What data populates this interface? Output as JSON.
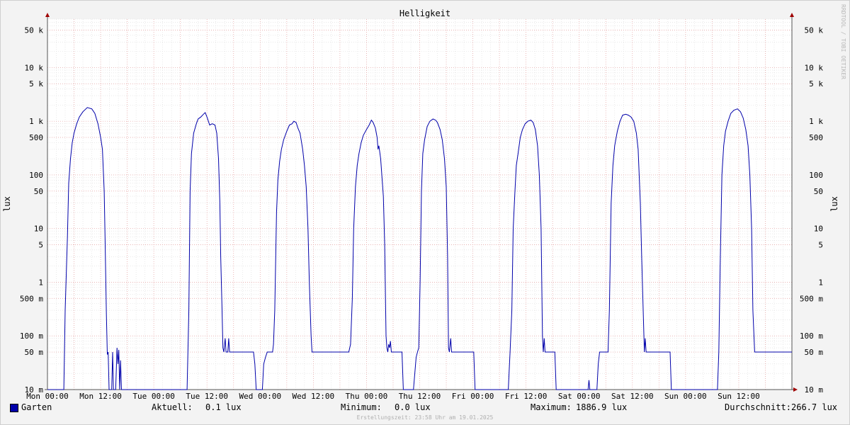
{
  "chart_data": {
    "type": "line",
    "title": "Helligkeit",
    "ylabel": "lux",
    "yscale": "log",
    "ylim": [
      0.01,
      80000
    ],
    "y_ticks": [
      0.01,
      0.05,
      0.1,
      0.5,
      1,
      5,
      10,
      50,
      100,
      500,
      1000,
      5000,
      10000,
      50000
    ],
    "y_tick_labels": [
      "10 m",
      "50 m",
      "100 m",
      "500 m",
      "1",
      "5",
      "10",
      "50",
      "100",
      "500",
      "1 k",
      "5 k",
      "10 k",
      "50 k"
    ],
    "x_ticks": [
      "Mon 00:00",
      "Mon 12:00",
      "Tue 00:00",
      "Tue 12:00",
      "Wed 00:00",
      "Wed 12:00",
      "Thu 00:00",
      "Thu 12:00",
      "Fri 00:00",
      "Fri 12:00",
      "Sat 00:00",
      "Sat 12:00",
      "Sun 00:00",
      "Sun 12:00"
    ],
    "x_hours": [
      0,
      12,
      24,
      36,
      48,
      60,
      72,
      84,
      96,
      108,
      120,
      132,
      144,
      156
    ],
    "xlim_hours": [
      0,
      168
    ],
    "grid": true,
    "series": [
      {
        "name": "Garten",
        "color": "#0000aa",
        "points": [
          [
            0,
            0.01
          ],
          [
            3.7,
            0.01
          ],
          [
            4.0,
            0.3
          ],
          [
            4.5,
            7
          ],
          [
            4.8,
            70
          ],
          [
            5.2,
            200
          ],
          [
            5.6,
            400
          ],
          [
            6.0,
            600
          ],
          [
            6.6,
            900
          ],
          [
            7.2,
            1200
          ],
          [
            8.0,
            1500
          ],
          [
            9.0,
            1800
          ],
          [
            10.0,
            1700
          ],
          [
            10.7,
            1400
          ],
          [
            11.4,
            900
          ],
          [
            12.0,
            500
          ],
          [
            12.4,
            300
          ],
          [
            12.8,
            50
          ],
          [
            13.0,
            7
          ],
          [
            13.3,
            0.25
          ],
          [
            13.5,
            0.045
          ],
          [
            13.7,
            0.05
          ],
          [
            13.9,
            0.01
          ],
          [
            14.5,
            0.01
          ],
          [
            14.7,
            0.05
          ],
          [
            14.9,
            0.01
          ],
          [
            15.4,
            0.01
          ],
          [
            15.7,
            0.06
          ],
          [
            15.9,
            0.03
          ],
          [
            16.1,
            0.055
          ],
          [
            16.3,
            0.01
          ],
          [
            16.5,
            0.035
          ],
          [
            16.7,
            0.01
          ],
          [
            24.0,
            0.01
          ],
          [
            31.5,
            0.01
          ],
          [
            31.7,
            0.05
          ],
          [
            31.9,
            0.3
          ],
          [
            32.2,
            50
          ],
          [
            32.5,
            250
          ],
          [
            33.0,
            600
          ],
          [
            33.6,
            900
          ],
          [
            34.0,
            1100
          ],
          [
            34.6,
            1200
          ],
          [
            35.2,
            1350
          ],
          [
            35.6,
            1450
          ],
          [
            36.0,
            1200
          ],
          [
            36.6,
            850
          ],
          [
            37.2,
            900
          ],
          [
            37.8,
            850
          ],
          [
            38.2,
            600
          ],
          [
            38.6,
            200
          ],
          [
            38.9,
            30
          ],
          [
            39.1,
            3
          ],
          [
            39.4,
            0.3
          ],
          [
            39.6,
            0.06
          ],
          [
            39.8,
            0.05
          ],
          [
            40.1,
            0.09
          ],
          [
            40.3,
            0.05
          ],
          [
            40.7,
            0.05
          ],
          [
            40.9,
            0.09
          ],
          [
            41.1,
            0.05
          ],
          [
            46.5,
            0.05
          ],
          [
            46.8,
            0.03
          ],
          [
            47.1,
            0.01
          ],
          [
            48.5,
            0.01
          ],
          [
            48.8,
            0.03
          ],
          [
            49.2,
            0.04
          ],
          [
            49.6,
            0.05
          ],
          [
            50.8,
            0.05
          ],
          [
            51.0,
            0.07
          ],
          [
            51.3,
            0.3
          ],
          [
            51.7,
            20
          ],
          [
            52.0,
            80
          ],
          [
            52.4,
            180
          ],
          [
            52.8,
            300
          ],
          [
            53.3,
            450
          ],
          [
            54.0,
            650
          ],
          [
            54.6,
            850
          ],
          [
            55.2,
            900
          ],
          [
            55.6,
            1000
          ],
          [
            56.1,
            950
          ],
          [
            56.5,
            750
          ],
          [
            57.0,
            600
          ],
          [
            57.6,
            300
          ],
          [
            58.0,
            150
          ],
          [
            58.4,
            60
          ],
          [
            58.8,
            10
          ],
          [
            59.1,
            1
          ],
          [
            59.5,
            0.1
          ],
          [
            59.7,
            0.05
          ],
          [
            68.0,
            0.05
          ],
          [
            68.4,
            0.07
          ],
          [
            68.8,
            0.5
          ],
          [
            69.1,
            10
          ],
          [
            69.5,
            60
          ],
          [
            69.9,
            150
          ],
          [
            70.3,
            250
          ],
          [
            70.8,
            400
          ],
          [
            71.3,
            550
          ],
          [
            72.0,
            700
          ],
          [
            72.6,
            850
          ],
          [
            73.1,
            1050
          ],
          [
            73.5,
            950
          ],
          [
            74.0,
            750
          ],
          [
            74.4,
            500
          ],
          [
            74.6,
            300
          ],
          [
            74.8,
            350
          ],
          [
            75.2,
            200
          ],
          [
            75.8,
            40
          ],
          [
            76.1,
            5
          ],
          [
            76.4,
            0.1
          ],
          [
            76.6,
            0.06
          ],
          [
            76.8,
            0.05
          ],
          [
            77.0,
            0.07
          ],
          [
            77.2,
            0.06
          ],
          [
            77.4,
            0.08
          ],
          [
            77.6,
            0.05
          ],
          [
            80.0,
            0.05
          ],
          [
            80.3,
            0.01
          ],
          [
            82.6,
            0.01
          ],
          [
            82.9,
            0.02
          ],
          [
            83.2,
            0.04
          ],
          [
            83.5,
            0.05
          ],
          [
            83.8,
            0.06
          ],
          [
            84.1,
            1
          ],
          [
            84.4,
            50
          ],
          [
            84.7,
            250
          ],
          [
            85.1,
            450
          ],
          [
            85.7,
            800
          ],
          [
            86.3,
            1000
          ],
          [
            87.0,
            1100
          ],
          [
            87.6,
            1050
          ],
          [
            88.0,
            950
          ],
          [
            88.6,
            700
          ],
          [
            89.1,
            450
          ],
          [
            89.6,
            200
          ],
          [
            90.0,
            60
          ],
          [
            90.3,
            3
          ],
          [
            90.5,
            0.06
          ],
          [
            90.7,
            0.05
          ],
          [
            91.0,
            0.09
          ],
          [
            91.2,
            0.05
          ],
          [
            96.2,
            0.05
          ],
          [
            96.5,
            0.01
          ],
          [
            104.0,
            0.01
          ],
          [
            104.4,
            0.05
          ],
          [
            104.8,
            0.3
          ],
          [
            105.1,
            10
          ],
          [
            105.5,
            50
          ],
          [
            105.8,
            150
          ],
          [
            106.2,
            250
          ],
          [
            106.7,
            500
          ],
          [
            107.2,
            700
          ],
          [
            107.8,
            900
          ],
          [
            108.4,
            1000
          ],
          [
            109.1,
            1050
          ],
          [
            109.6,
            950
          ],
          [
            110.1,
            700
          ],
          [
            110.6,
            350
          ],
          [
            111.0,
            100
          ],
          [
            111.4,
            10
          ],
          [
            111.7,
            0.1
          ],
          [
            111.9,
            0.05
          ],
          [
            112.1,
            0.09
          ],
          [
            112.3,
            0.05
          ],
          [
            114.5,
            0.05
          ],
          [
            114.8,
            0.01
          ],
          [
            122.0,
            0.01
          ],
          [
            122.2,
            0.015
          ],
          [
            122.4,
            0.01
          ],
          [
            124.0,
            0.01
          ],
          [
            124.3,
            0.03
          ],
          [
            124.6,
            0.05
          ],
          [
            126.5,
            0.05
          ],
          [
            126.8,
            0.3
          ],
          [
            127.2,
            30
          ],
          [
            127.6,
            150
          ],
          [
            128.0,
            350
          ],
          [
            128.6,
            650
          ],
          [
            129.2,
            1000
          ],
          [
            129.8,
            1300
          ],
          [
            130.5,
            1350
          ],
          [
            131.1,
            1300
          ],
          [
            131.7,
            1200
          ],
          [
            132.3,
            1000
          ],
          [
            132.9,
            600
          ],
          [
            133.3,
            300
          ],
          [
            133.8,
            30
          ],
          [
            134.1,
            3
          ],
          [
            134.5,
            0.2
          ],
          [
            134.7,
            0.05
          ],
          [
            134.9,
            0.09
          ],
          [
            135.1,
            0.05
          ],
          [
            140.5,
            0.05
          ],
          [
            140.8,
            0.01
          ],
          [
            151.2,
            0.01
          ],
          [
            151.5,
            0.05
          ],
          [
            151.8,
            2
          ],
          [
            152.2,
            100
          ],
          [
            152.6,
            350
          ],
          [
            153.0,
            650
          ],
          [
            153.6,
            1000
          ],
          [
            154.2,
            1400
          ],
          [
            154.9,
            1600
          ],
          [
            155.7,
            1700
          ],
          [
            156.4,
            1500
          ],
          [
            157.0,
            1150
          ],
          [
            157.6,
            700
          ],
          [
            158.1,
            350
          ],
          [
            158.5,
            100
          ],
          [
            158.9,
            10
          ],
          [
            159.2,
            0.3
          ],
          [
            159.6,
            0.05
          ],
          [
            168,
            0.05
          ]
        ]
      }
    ]
  },
  "legend": {
    "series_label": "Garten",
    "current_label": "Aktuell:",
    "current_value": "0.1 lux",
    "min_label": "Minimum:",
    "min_value": "0.0 lux",
    "max_label": "Maximum:",
    "max_value": "1886.9 lux",
    "avg_label": "Durchschnitt:",
    "avg_value": "266.7 lux"
  },
  "footnote": "Erstellungszeit: 23:58 Uhr am 19.01.2025",
  "watermark": "RRDTOOL / TOBI OETIKER",
  "colors": {
    "line": "#0000aa",
    "major_grid": "#e8a0a0",
    "minor_grid": "#dcdcdc",
    "background": "#f3f3f3",
    "canvas": "#ffffff"
  }
}
